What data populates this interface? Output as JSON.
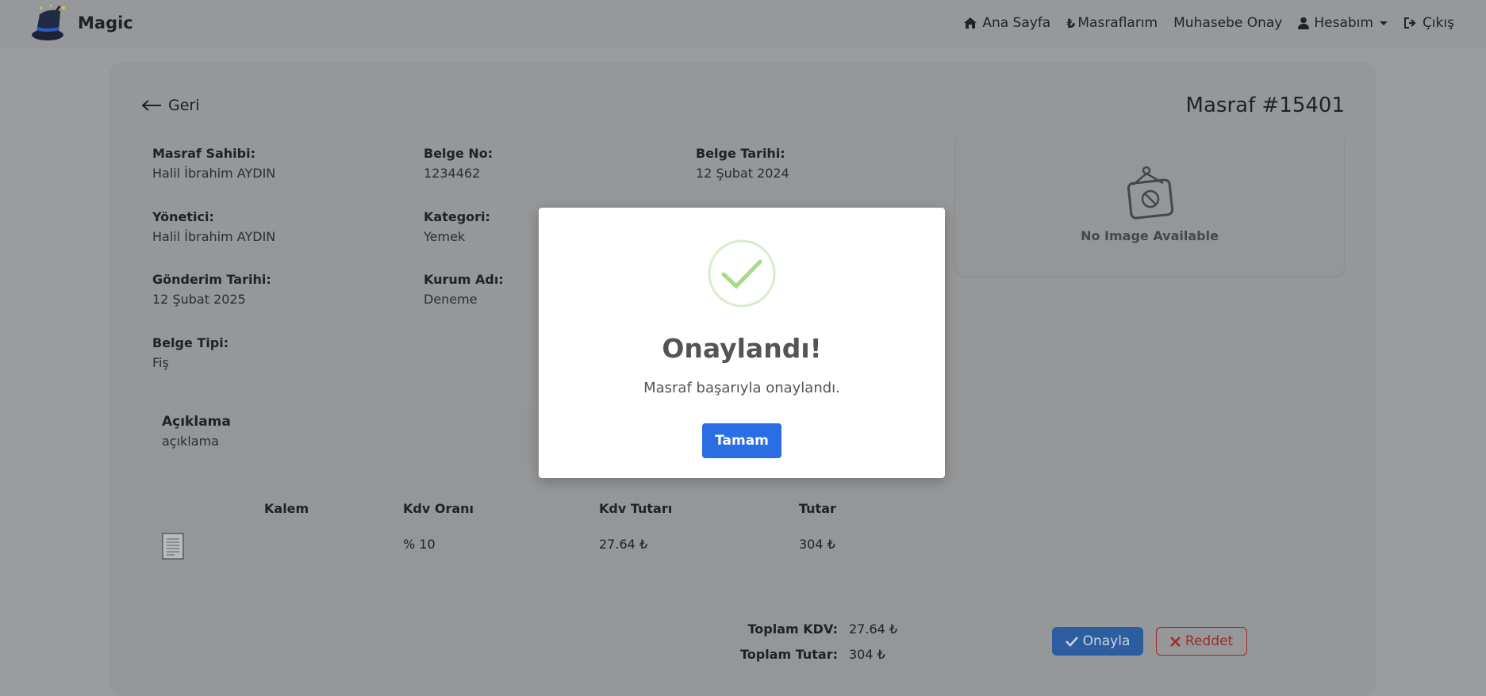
{
  "brand": {
    "name": "Magic"
  },
  "nav": {
    "home": "Ana Sayfa",
    "expenses": "Masraflarım",
    "accounting": "Muhasebe Onay",
    "account": "Hesabım",
    "logout": "Çıkış"
  },
  "page": {
    "back": "Geri",
    "title": "Masraf #15401"
  },
  "fields": {
    "owner_label": "Masraf Sahibi:",
    "owner": "Halil İbrahim AYDIN",
    "docno_label": "Belge No:",
    "docno": "1234462",
    "docdate_label": "Belge Tarihi:",
    "docdate": "12 Şubat 2024",
    "manager_label": "Yönetici:",
    "manager": "Halil İbrahim AYDIN",
    "category_label": "Kategori:",
    "category": "Yemek",
    "sentdate_label": "Gönderim Tarihi:",
    "sentdate": "12 Şubat 2025",
    "institution_label": "Kurum Adı:",
    "institution": "Deneme",
    "doctype_label": "Belge Tipi:",
    "doctype": "Fiş"
  },
  "image": {
    "placeholder": "No Image Available"
  },
  "description": {
    "label": "Açıklama",
    "value": "açıklama"
  },
  "items": {
    "headers": [
      "Kalem",
      "Kdv Oranı",
      "Kdv Tutarı",
      "Tutar"
    ],
    "rows": [
      {
        "item": "",
        "vat_rate": "% 10",
        "vat_amount": "27.64 ₺",
        "amount": "304 ₺"
      }
    ]
  },
  "totals": {
    "vat_label": "Toplam KDV:",
    "vat": "27.64 ₺",
    "total_label": "Toplam Tutar:",
    "total": "304 ₺"
  },
  "actions": {
    "approve": "Onayla",
    "reject": "Reddet"
  },
  "modal": {
    "title": "Onaylandı!",
    "text": "Masraf başarıyla onaylandı.",
    "ok": "Tamam"
  },
  "colors": {
    "primary": "#2a6ee4",
    "success": "#a5dc86",
    "danger": "#a02c2c"
  }
}
